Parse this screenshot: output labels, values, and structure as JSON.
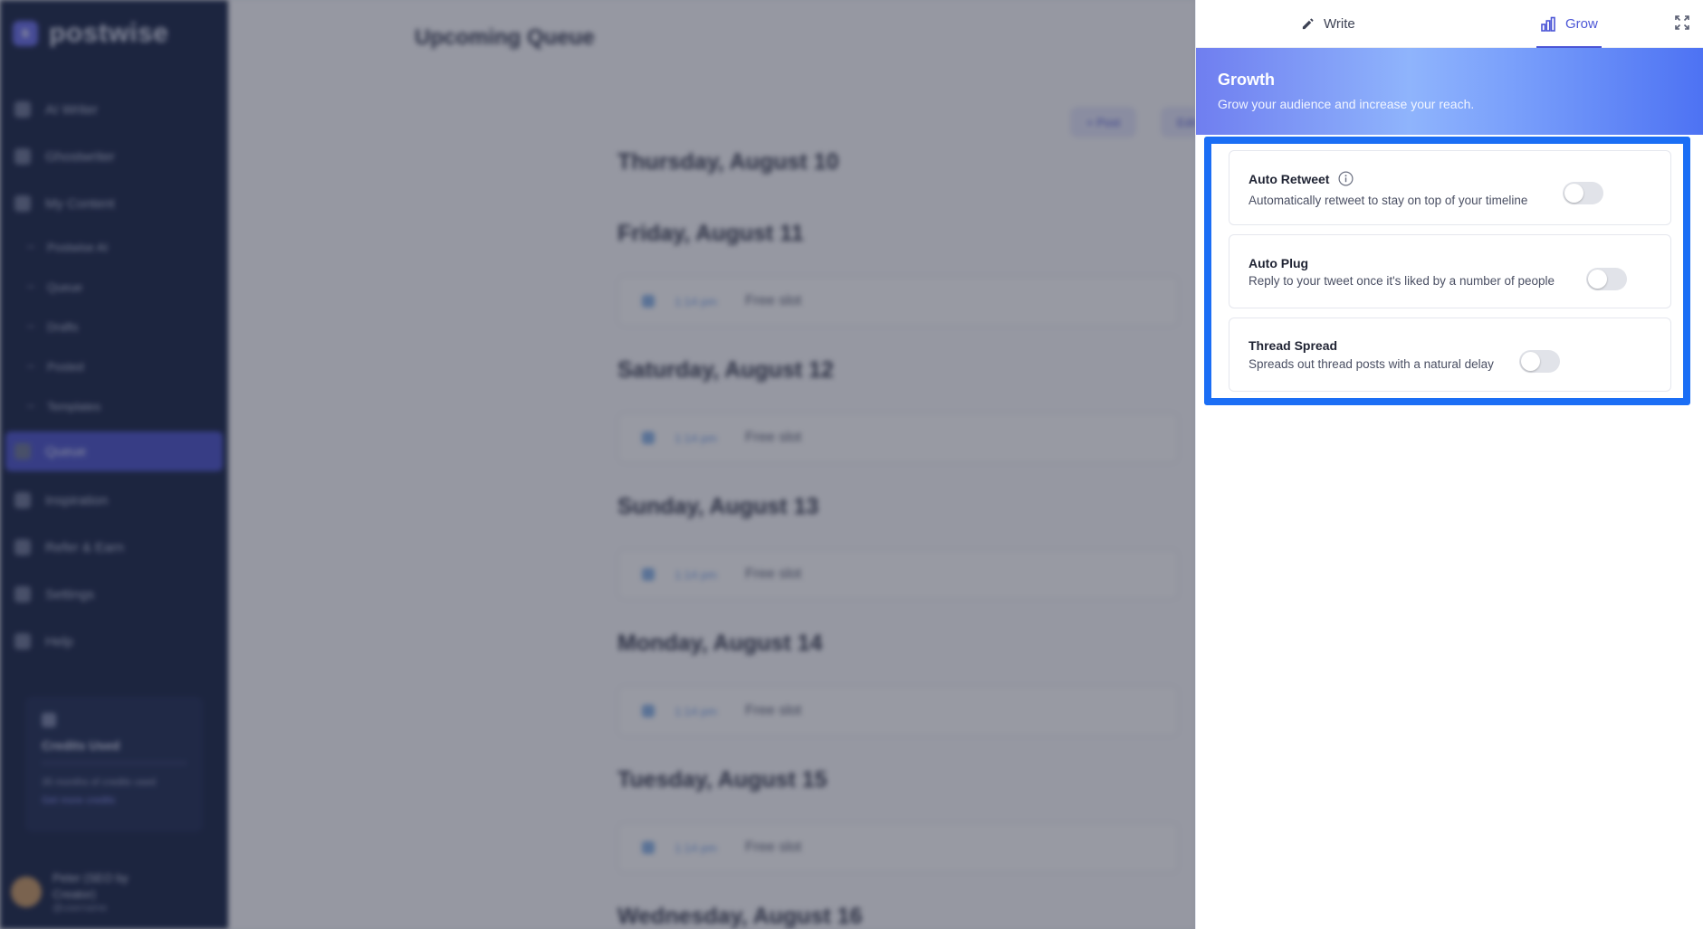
{
  "app": {
    "brand": {
      "logo_letter": "s",
      "name": "postwise"
    },
    "nav": [
      {
        "label": "AI Writer",
        "sub": false,
        "active": false
      },
      {
        "label": "Ghostwriter",
        "sub": false,
        "active": false
      },
      {
        "label": "My Content",
        "sub": false,
        "active": false
      },
      {
        "label": "Postwise AI",
        "sub": true,
        "active": false
      },
      {
        "label": "Queue",
        "sub": true,
        "active": false
      },
      {
        "label": "Drafts",
        "sub": true,
        "active": false
      },
      {
        "label": "Posted",
        "sub": true,
        "active": false
      },
      {
        "label": "Templates",
        "sub": true,
        "active": false
      },
      {
        "label": "Queue",
        "sub": false,
        "active": true
      },
      {
        "label": "Inspiration",
        "sub": false,
        "active": false
      },
      {
        "label": "Refer & Earn",
        "sub": false,
        "active": false
      },
      {
        "label": "Settings",
        "sub": false,
        "active": false
      },
      {
        "label": "Help",
        "sub": false,
        "active": false
      }
    ],
    "credits": {
      "title": "Credits Used",
      "text": "35 months of credits used",
      "link": "Get more credits"
    },
    "user": {
      "name": "Peter (SEO by",
      "name2": "Creator)",
      "sub": "@username"
    },
    "main": {
      "title": "Upcoming Queue",
      "buttons": [
        "+ Post",
        "Edit"
      ],
      "slot_time": "1:14 pm",
      "slot_label": "Free slot",
      "days": [
        {
          "label": "Thursday, August 10",
          "has_slot": false
        },
        {
          "label": "Friday, August 11",
          "has_slot": true
        },
        {
          "label": "Saturday, August 12",
          "has_slot": true
        },
        {
          "label": "Sunday, August 13",
          "has_slot": true
        },
        {
          "label": "Monday, August 14",
          "has_slot": true
        },
        {
          "label": "Tuesday, August 15",
          "has_slot": true
        },
        {
          "label": "Wednesday, August 16",
          "has_slot": false
        }
      ]
    }
  },
  "panel": {
    "tabs": {
      "write_label": "Write",
      "grow_label": "Grow"
    },
    "banner": {
      "title": "Growth",
      "subtitle": "Grow your audience and increase your reach."
    },
    "features": [
      {
        "title": "Auto Retweet",
        "description": "Automatically retweet to stay on top of your timeline",
        "enabled": false,
        "info_icon": "info-icon"
      },
      {
        "title": "Auto Plug",
        "description": "Reply to your tweet once it's liked by a number of people",
        "enabled": false
      },
      {
        "title": "Thread Spread",
        "description": "Spreads out thread posts with a natural delay",
        "enabled": false
      }
    ],
    "colors": {
      "accent": "#4b55d6",
      "highlight": "#1b6ef5",
      "toggle_off": "#e1e3e9"
    }
  }
}
